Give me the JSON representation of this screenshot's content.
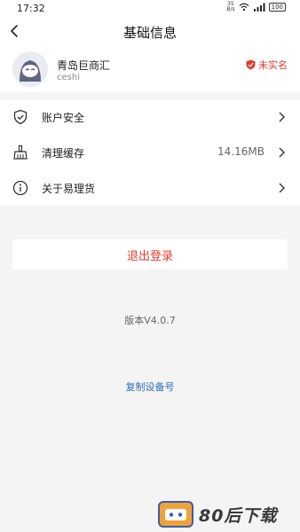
{
  "status_bar": {
    "time": "17:32",
    "net_speed_value": "35",
    "net_speed_unit": "B/s",
    "battery": "100"
  },
  "header": {
    "title": "基础信息"
  },
  "profile": {
    "company": "青岛巨商汇",
    "username": "ceshi",
    "verify_badge": "未实名"
  },
  "menu": {
    "items": [
      {
        "label": "账户安全",
        "icon": "shield-check-icon",
        "value": ""
      },
      {
        "label": "清理缓存",
        "icon": "broom-icon",
        "value": "14.16MB"
      },
      {
        "label": "关于易理货",
        "icon": "info-icon",
        "value": ""
      }
    ]
  },
  "logout": {
    "label": "退出登录"
  },
  "version": "版本V4.0.7",
  "copy_device": "复制设备号",
  "watermark": {
    "text": "80后下载"
  },
  "colors": {
    "accent_red": "#e23b2e",
    "link_blue": "#2f6fb5",
    "background": "#f4f4f4"
  }
}
